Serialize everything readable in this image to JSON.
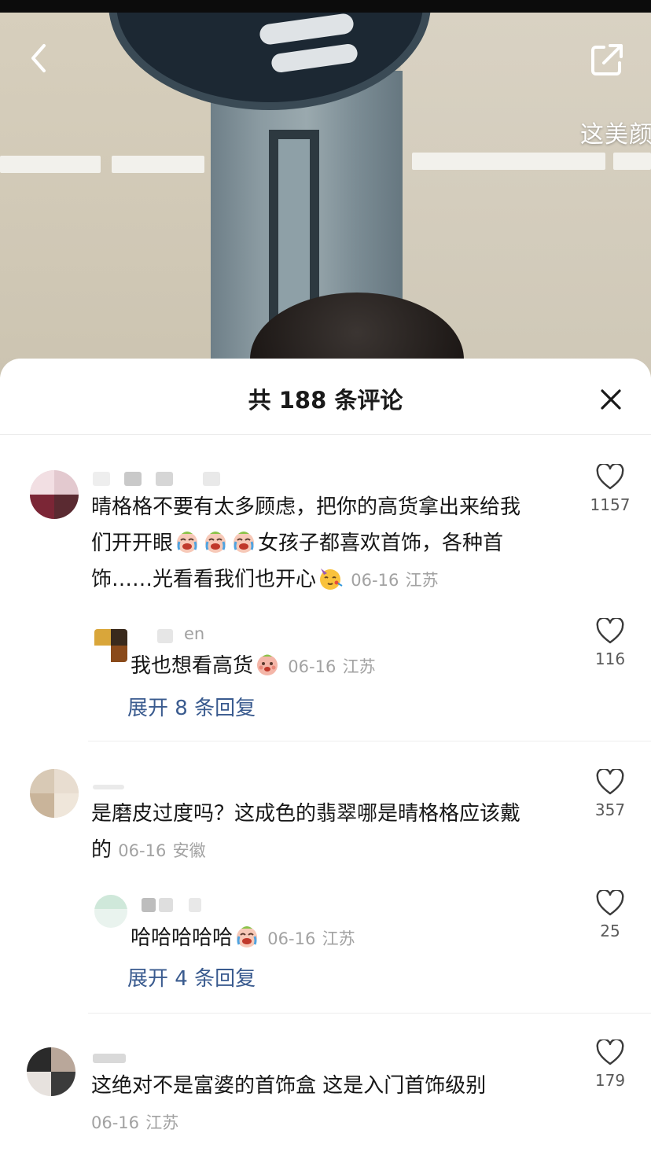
{
  "video": {
    "overlay_text": "这美颜"
  },
  "sheet": {
    "title": "共 188 条评论"
  },
  "icons": {
    "back": "chevron-left-icon",
    "share": "share-icon",
    "close": "close-icon",
    "like": "heart-icon",
    "cry_laugh": "crying-laugh-emoji",
    "party": "party-face-emoji",
    "pout": "pout-emoji"
  },
  "comments": [
    {
      "name_tail": "",
      "text_line1": "晴格格不要有太多顾虑，把你的高货拿出来给我",
      "text_line2_a": "们开开眼",
      "text_line2_b": "女孩子都喜欢首饰，各种首",
      "text_line3": "饰……光看看我们也开心",
      "date": "06-16",
      "region": "江苏",
      "likes": "1157"
    },
    {
      "name_tail": "en",
      "text": "我也想看高货",
      "date": "06-16",
      "region": "江苏",
      "likes": "116"
    },
    {
      "expand_label": "展开 8 条回复"
    },
    {
      "text_line1": "是磨皮过度吗？这成色的翡翠哪是晴格格应该戴",
      "text_line2": "的",
      "date": "06-16",
      "region": "安徽",
      "likes": "357"
    },
    {
      "text": "哈哈哈哈哈",
      "date": "06-16",
      "region": "江苏",
      "likes": "25"
    },
    {
      "expand_label": "展开 4 条回复"
    },
    {
      "text": "这绝对不是富婆的首饰盒 这是入门首饰级别",
      "date": "06-16",
      "region": "江苏",
      "likes": "179"
    }
  ]
}
